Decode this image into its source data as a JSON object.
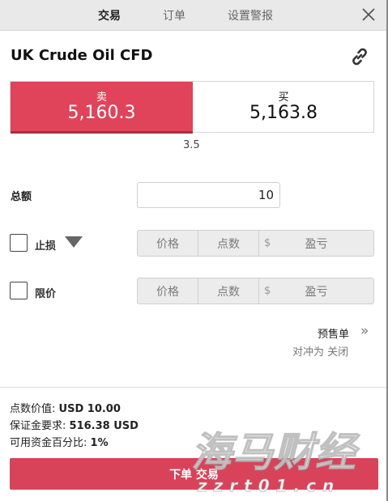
{
  "tabs": [
    {
      "label": "交易",
      "active": true
    },
    {
      "label": "订单",
      "active": false
    },
    {
      "label": "设置警报",
      "active": false
    }
  ],
  "title": "UK Crude Oil CFD",
  "sell": {
    "label": "卖",
    "price": "5,160.3",
    "color": "#e0445a"
  },
  "buy": {
    "label": "买",
    "price": "5,163.8"
  },
  "spread": "3.5",
  "amount": {
    "label": "总额",
    "value": "10"
  },
  "stop": {
    "label": "止损",
    "price_placeholder": "价格",
    "points_placeholder": "点数",
    "currency": "$",
    "pnl_placeholder": "盈亏",
    "checked": false
  },
  "limit": {
    "label": "限价",
    "price_placeholder": "价格",
    "points_placeholder": "点数",
    "currency": "$",
    "pnl_placeholder": "盈亏",
    "checked": false
  },
  "advanced": {
    "label": "预售单",
    "hedge_text": "对冲为 关闭"
  },
  "info": {
    "point_value_label": "点数价值:",
    "point_value": "USD 10.00",
    "margin_label": "保证金要求:",
    "margin": "516.38 USD",
    "funds_label": "可用资金百分比:",
    "funds": "1%"
  },
  "submit_label": "下单 交易",
  "watermark": {
    "text": "海马财经",
    "url": "zzrt01.cn"
  },
  "icons": [
    "close-icon",
    "link-icon",
    "chevron-double-right-icon",
    "triangle-down-icon"
  ]
}
